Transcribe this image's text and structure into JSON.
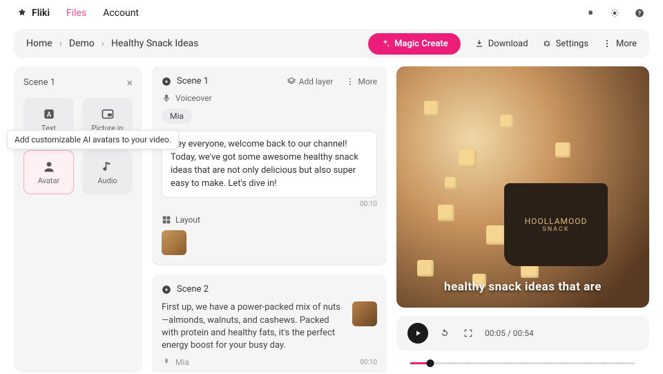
{
  "brand": "Fliki",
  "nav": {
    "files": "Files",
    "account": "Account"
  },
  "topicons": {
    "fire": "fire-icon",
    "sun": "theme-icon",
    "help": "help-icon"
  },
  "crumbs": [
    "Home",
    "Demo",
    "Healthy Snack Ideas"
  ],
  "actions": {
    "magic": "Magic Create",
    "download": "Download",
    "settings": "Settings",
    "more": "More"
  },
  "sidebar": {
    "title": "Scene 1",
    "tiles": [
      {
        "label": "Text",
        "icon": "text"
      },
      {
        "label": "Picture in",
        "icon": "pip"
      },
      {
        "label": "Avatar",
        "icon": "avatar",
        "selected": true
      },
      {
        "label": "Audio",
        "icon": "audio"
      }
    ],
    "tooltip": "Add customizable AI avatars to your video."
  },
  "scenes": [
    {
      "title": "Scene 1",
      "addlayer": "Add layer",
      "more": "More",
      "voiceover_label": "Voiceover",
      "voice_chip": "Mia",
      "script": "Hey everyone, welcome back to our channel! Today, we've got some awesome healthy snack ideas that are not only delicious but also super easy to make. Let's dive in!",
      "time": "00:10",
      "layout_label": "Layout"
    },
    {
      "title": "Scene 2",
      "script": "First up, we have a power-packed mix of nuts—almonds, walnuts, and cashews. Packed with protein and healthy fats, it's the perfect energy boost for your busy day.",
      "voice": "Mia",
      "time": "00:10"
    }
  ],
  "preview": {
    "caption": "healthy snack ideas that are",
    "cup_l1": "HOOLLAMOOD",
    "cup_l2": "SNACK"
  },
  "player": {
    "current": "00:05",
    "total": "00:54"
  }
}
